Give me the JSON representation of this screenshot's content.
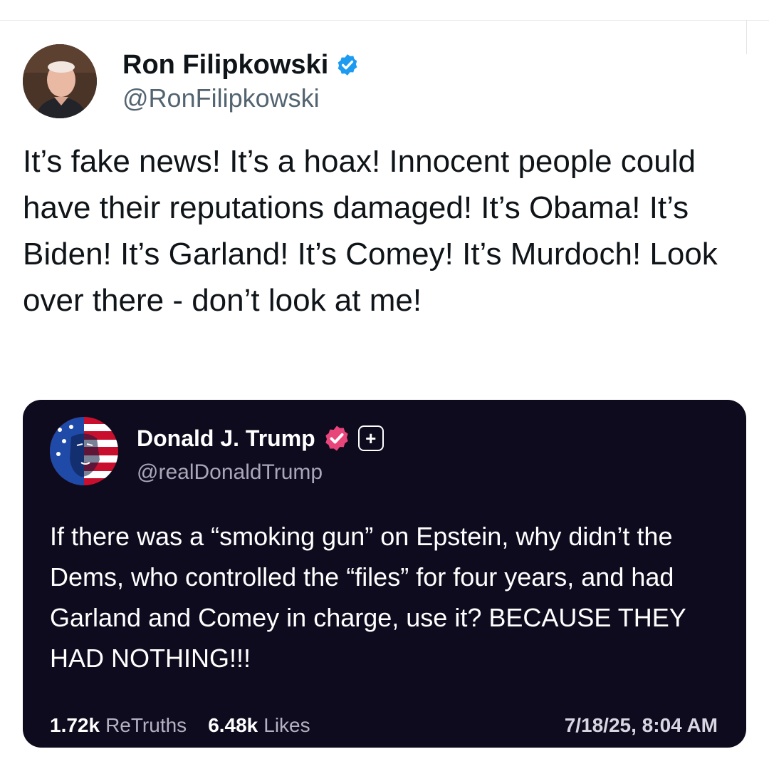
{
  "post": {
    "author": {
      "name": "Ron Filipkowski",
      "handle": "@RonFilipkowski",
      "verified_color": "#1d9bf0",
      "avatar_icon": "profile-photo"
    },
    "text": "It’s fake news! It’s a hoax! Innocent people could have their reputations damaged! It’s Obama! It’s Biden! It’s Garland! It’s Comey! It’s Murdoch! Look over there - don’t look at me!"
  },
  "quoted": {
    "author": {
      "name": "Donald J. Trump",
      "handle": "@realDonaldTrump",
      "verified_color": "#e8457a",
      "plus_badge": "+",
      "avatar_icon": "flag-portrait"
    },
    "text": "If there was a “smoking gun” on Epstein, why didn’t the Dems, who controlled the “files” for four years, and had Garland and Comey in charge, use it? BECAUSE THEY HAD NOTHING!!!",
    "stats": {
      "retruths_count": "1.72k",
      "retruths_label": "ReTruths",
      "likes_count": "6.48k",
      "likes_label": "Likes"
    },
    "timestamp": "7/18/25, 8:04 AM",
    "background": "#0e0b1e"
  }
}
